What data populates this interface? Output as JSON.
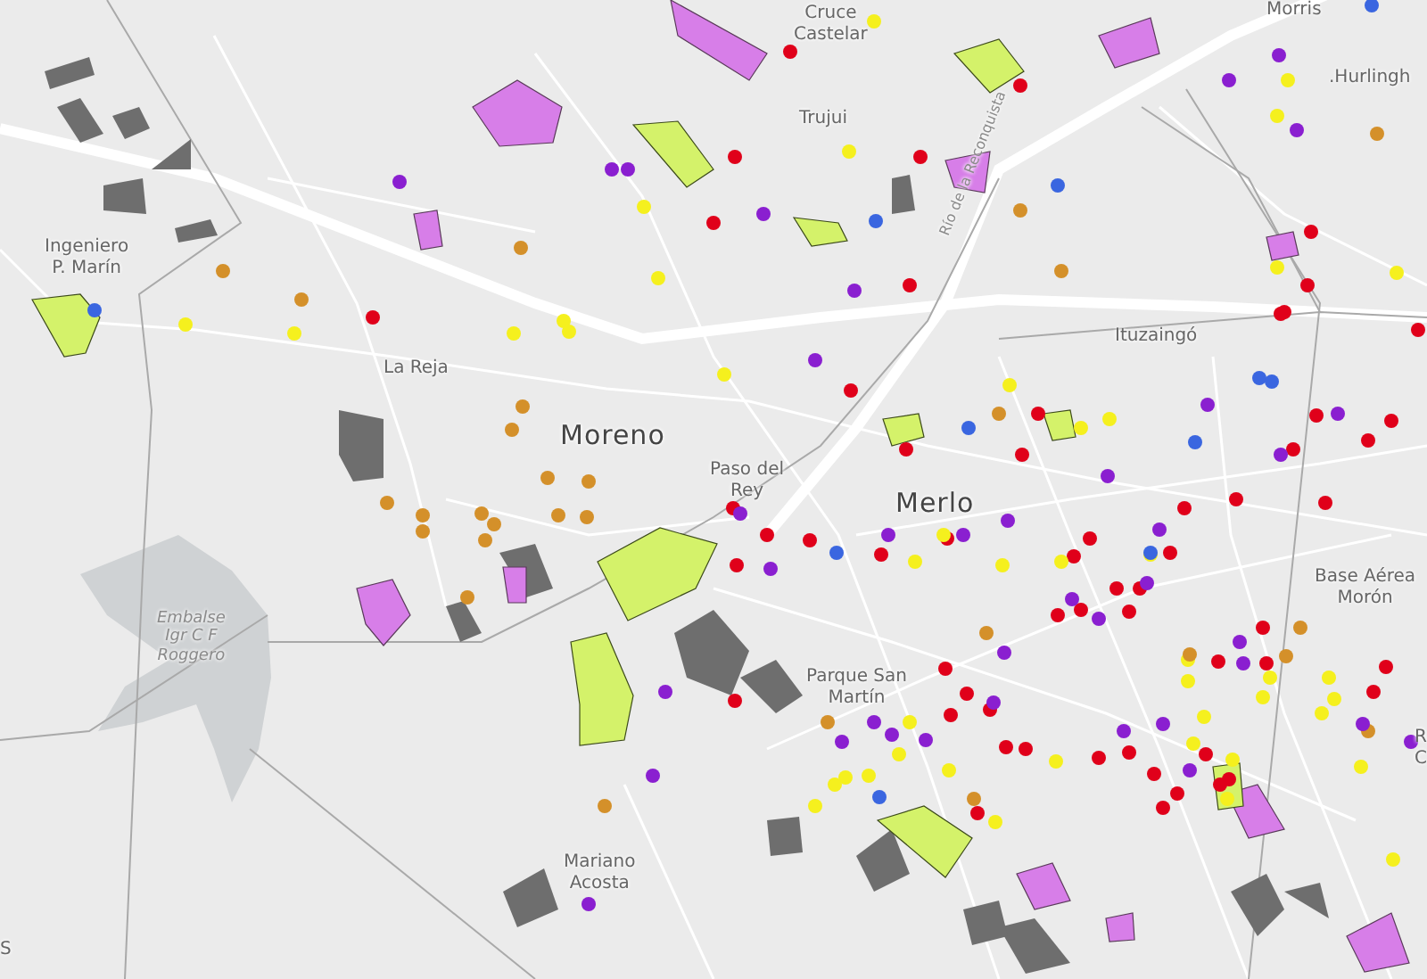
{
  "map": {
    "labels": [
      {
        "kind": "locality",
        "text": "Cruce\nCastelar"
      },
      {
        "kind": "locality",
        "text": "Morris"
      },
      {
        "kind": "locality",
        "text": ".Hurlingh"
      },
      {
        "kind": "locality",
        "text": "Trujui"
      },
      {
        "kind": "road",
        "text": "Río de la Reconquista"
      },
      {
        "kind": "locality",
        "text": "Ingeniero\nP. Marín"
      },
      {
        "kind": "locality",
        "text": "Ituzaingó"
      },
      {
        "kind": "locality",
        "text": "La Reja"
      },
      {
        "kind": "city",
        "text": "Moreno"
      },
      {
        "kind": "locality",
        "text": "Paso del\nRey"
      },
      {
        "kind": "city",
        "text": "Merlo"
      },
      {
        "kind": "locality",
        "text": "Base Aérea\nMorón"
      },
      {
        "kind": "locality",
        "text": "R\nC"
      },
      {
        "kind": "water",
        "text": "Embalse\nIgr C F\nRoggero"
      },
      {
        "kind": "locality",
        "text": "Parque San\nMartín"
      },
      {
        "kind": "locality",
        "text": "Mariano\nAcosta"
      },
      {
        "kind": "locality",
        "text": "S"
      }
    ],
    "point_layers": [
      {
        "color": "#e0001a"
      },
      {
        "color": "#f5f01e"
      },
      {
        "color": "#d4902a"
      },
      {
        "color": "#8a1fd0"
      },
      {
        "color": "#3a66e0"
      }
    ]
  }
}
